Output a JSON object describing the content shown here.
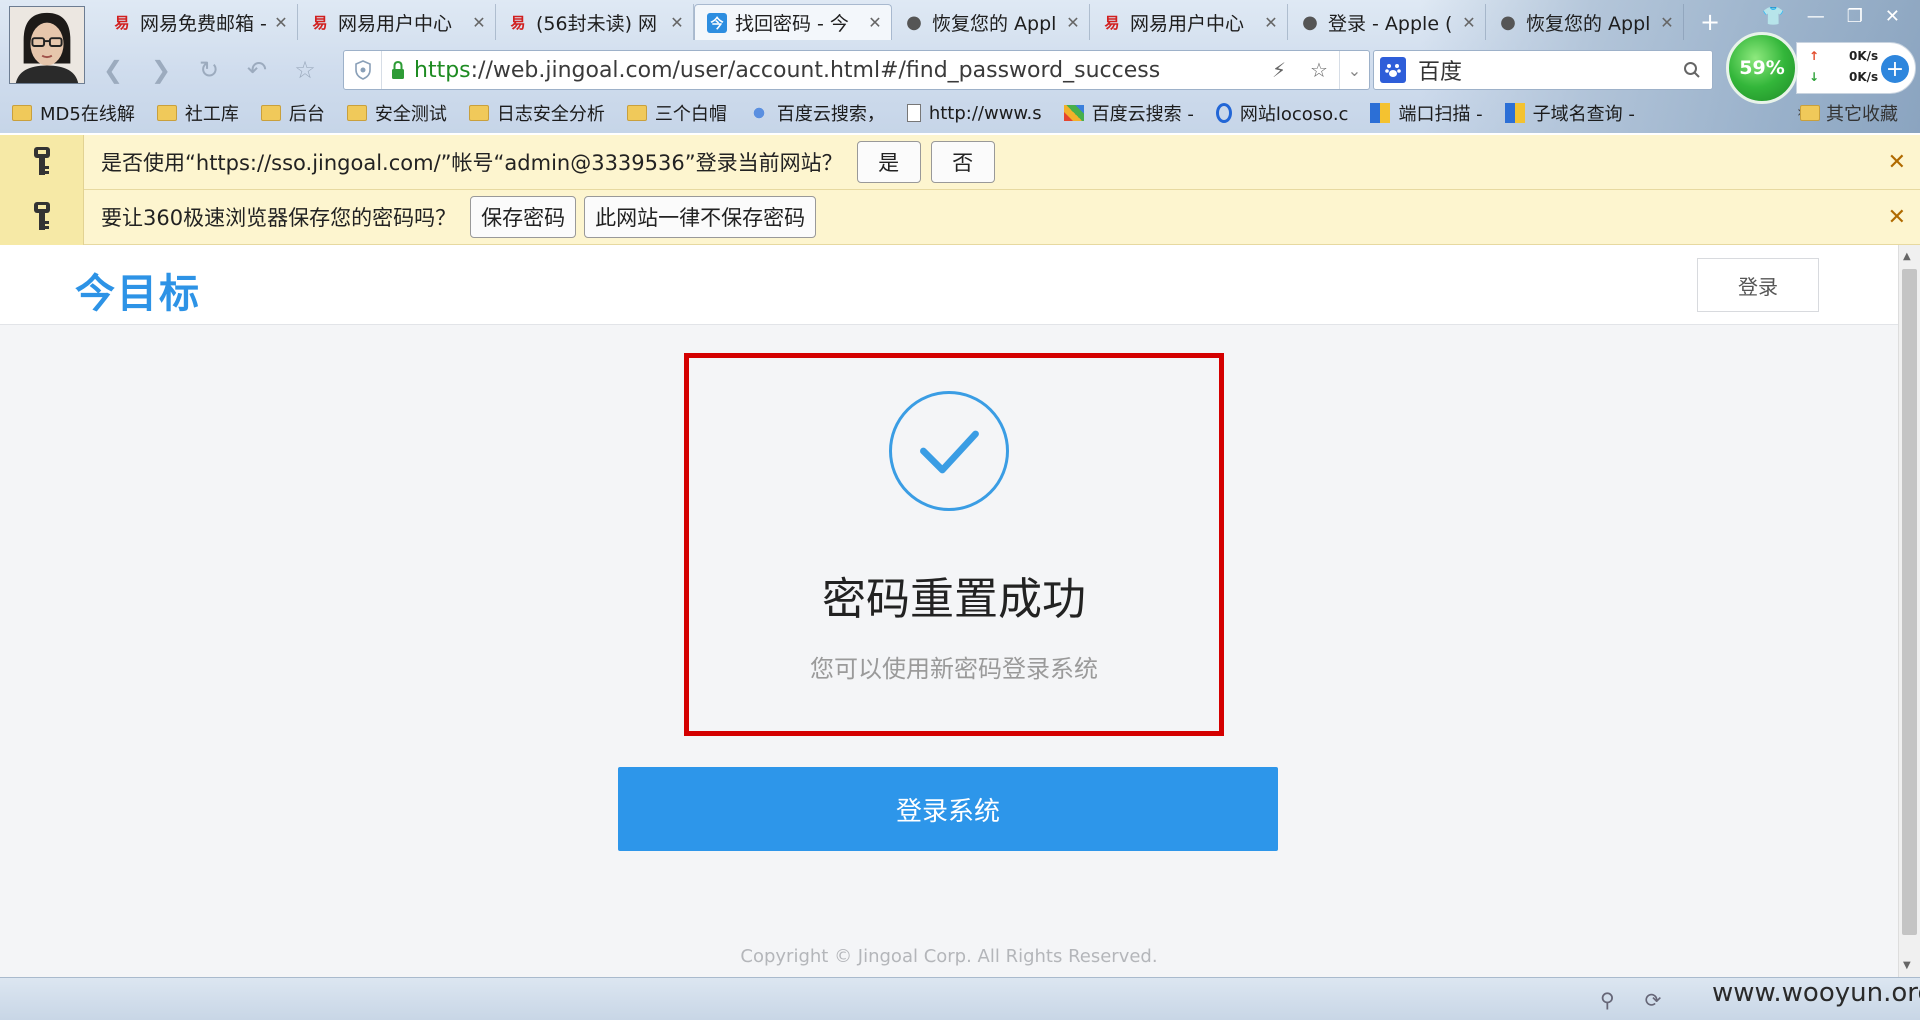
{
  "browser": {
    "tabs": [
      {
        "icon": "netease-icon",
        "glyph": "易",
        "label": "网易免费邮箱 -",
        "active": false
      },
      {
        "icon": "netease-icon",
        "glyph": "易",
        "label": "网易用户中心",
        "active": false
      },
      {
        "icon": "netease-icon",
        "glyph": "易",
        "label": "(56封未读) 网",
        "active": false
      },
      {
        "icon": "jingoal-icon",
        "glyph": "今",
        "label": "找回密码 - 今",
        "active": true
      },
      {
        "icon": "apple-icon",
        "glyph": "",
        "label": "恢复您的 Appl",
        "active": false
      },
      {
        "icon": "netease-icon",
        "glyph": "易",
        "label": "网易用户中心",
        "active": false
      },
      {
        "icon": "apple-icon",
        "glyph": "",
        "label": "登录 - Apple (",
        "active": false
      },
      {
        "icon": "apple-icon",
        "glyph": "",
        "label": "恢复您的 Appl",
        "active": false
      }
    ],
    "url_scheme": "https",
    "url_rest": "://web.jingoal.com/user/account.html#/find_password_success",
    "search_engine_value": "百度",
    "speed": {
      "percent": "59%",
      "up": "0K/s",
      "down": "0K/s"
    },
    "bookmarks": [
      {
        "icon": "folder-icon",
        "label": "MD5在线解"
      },
      {
        "icon": "folder-icon",
        "label": "社工库"
      },
      {
        "icon": "folder-icon",
        "label": "后台"
      },
      {
        "icon": "folder-icon",
        "label": "安全测试"
      },
      {
        "icon": "folder-icon",
        "label": "日志安全分析"
      },
      {
        "icon": "folder-icon",
        "label": "三个白帽"
      },
      {
        "icon": "baidu-cloud-icon",
        "label": "百度云搜索，"
      },
      {
        "icon": "page-icon",
        "label": "http://www.s"
      },
      {
        "icon": "puzzle-icon",
        "label": "百度云搜索 -"
      },
      {
        "icon": "site-icon",
        "label": "网站locoso.c"
      },
      {
        "icon": "tool-icon",
        "label": "端口扫描 -"
      },
      {
        "icon": "tool-icon",
        "label": "子域名查询 -"
      }
    ],
    "bookmarks_more": "»",
    "other_bookmarks": "其它收藏"
  },
  "infobars": {
    "login_prompt": {
      "message": "是否使用“https://sso.jingoal.com/”帐号“admin@3339536”登录当前网站？",
      "yes": "是",
      "no": "否"
    },
    "save_prompt": {
      "message": "要让360极速浏览器保存您的密码吗？",
      "save": "保存密码",
      "never": "此网站一律不保存密码"
    },
    "close": "✕"
  },
  "site": {
    "logo": "今目标",
    "login_button": "登录",
    "success_title": "密码重置成功",
    "success_subtitle": "您可以使用新密码登录系统",
    "enter_button": "登录系统",
    "copyright": "Copyright © Jingoal Corp. All Rights Reserved."
  },
  "watermark": "www.wooyun.org",
  "colors": {
    "accent": "#2d96ea",
    "highlight_box": "#d40000",
    "infobar": "#fdf5cf"
  }
}
